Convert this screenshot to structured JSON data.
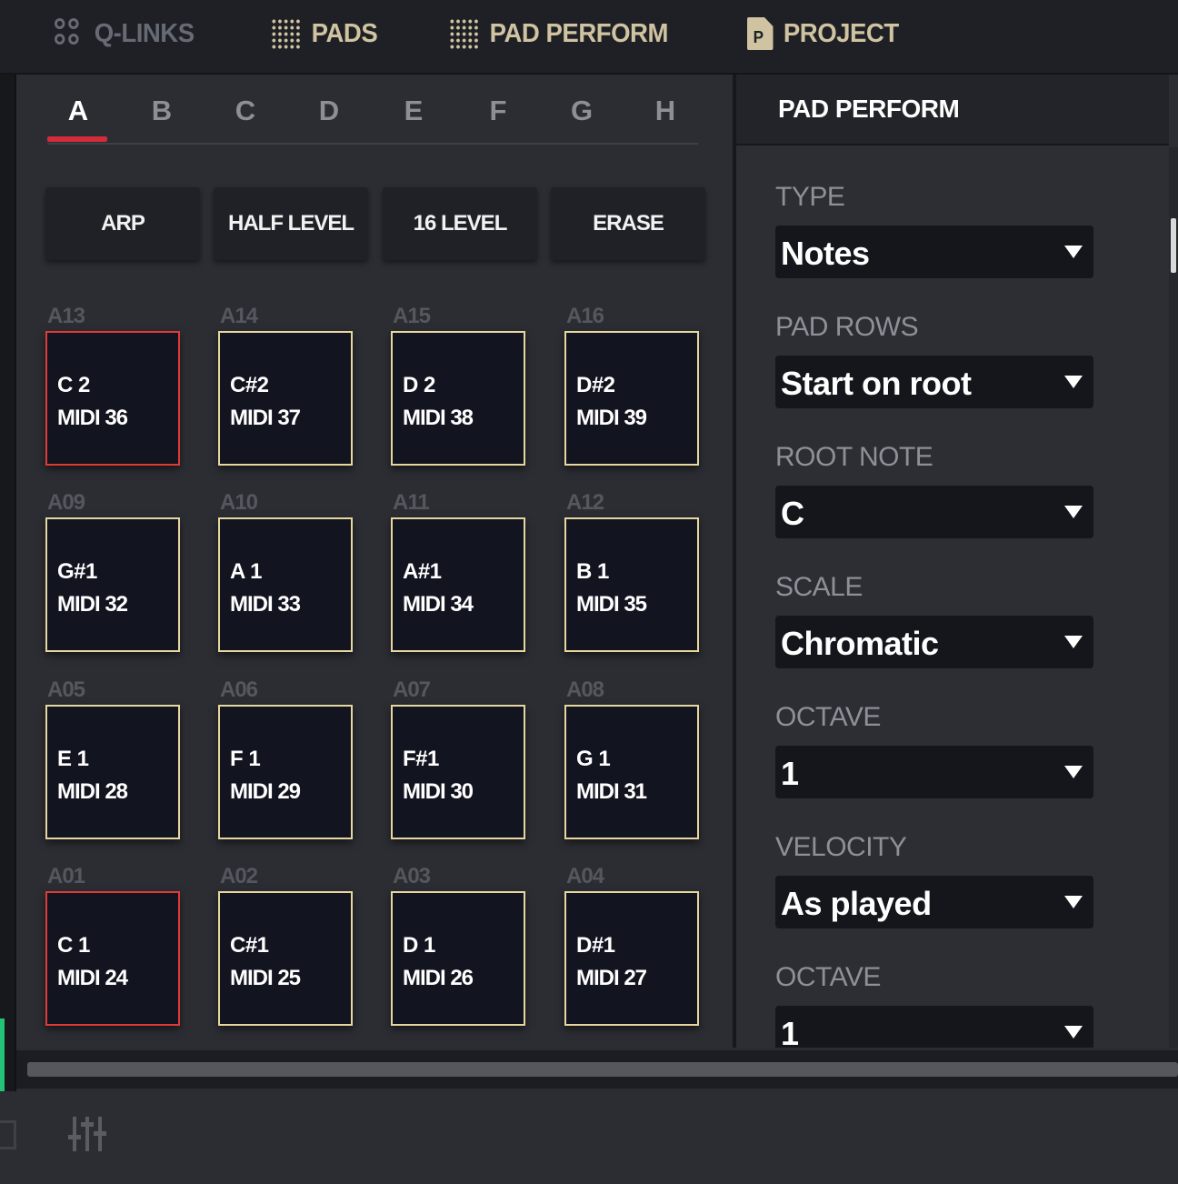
{
  "nav": {
    "items": [
      {
        "label": "Q-LINKS",
        "icon": "qlinks-icon"
      },
      {
        "label": "PADS",
        "icon": "grid-icon"
      },
      {
        "label": "PAD PERFORM",
        "icon": "grid-icon"
      },
      {
        "label": "PROJECT",
        "icon": "document-icon",
        "icon_letter": "P"
      }
    ]
  },
  "banks": [
    "A",
    "B",
    "C",
    "D",
    "E",
    "F",
    "G",
    "H"
  ],
  "active_bank": "A",
  "tools": [
    "ARP",
    "HALF LEVEL",
    "16 LEVEL",
    "ERASE"
  ],
  "pads": [
    {
      "id": "A13",
      "note": "C 2",
      "midi": "MIDI 36",
      "root": true
    },
    {
      "id": "A14",
      "note": "C#2",
      "midi": "MIDI 37",
      "root": false
    },
    {
      "id": "A15",
      "note": "D 2",
      "midi": "MIDI 38",
      "root": false
    },
    {
      "id": "A16",
      "note": "D#2",
      "midi": "MIDI 39",
      "root": false
    },
    {
      "id": "A09",
      "note": "G#1",
      "midi": "MIDI 32",
      "root": false
    },
    {
      "id": "A10",
      "note": "A 1",
      "midi": "MIDI 33",
      "root": false
    },
    {
      "id": "A11",
      "note": "A#1",
      "midi": "MIDI 34",
      "root": false
    },
    {
      "id": "A12",
      "note": "B 1",
      "midi": "MIDI 35",
      "root": false
    },
    {
      "id": "A05",
      "note": "E 1",
      "midi": "MIDI 28",
      "root": false
    },
    {
      "id": "A06",
      "note": "F 1",
      "midi": "MIDI 29",
      "root": false
    },
    {
      "id": "A07",
      "note": "F#1",
      "midi": "MIDI 30",
      "root": false
    },
    {
      "id": "A08",
      "note": "G 1",
      "midi": "MIDI 31",
      "root": false
    },
    {
      "id": "A01",
      "note": "C 1",
      "midi": "MIDI 24",
      "root": true
    },
    {
      "id": "A02",
      "note": "C#1",
      "midi": "MIDI 25",
      "root": false
    },
    {
      "id": "A03",
      "note": "D 1",
      "midi": "MIDI 26",
      "root": false
    },
    {
      "id": "A04",
      "note": "D#1",
      "midi": "MIDI 27",
      "root": false
    }
  ],
  "panel": {
    "title": "PAD PERFORM",
    "fields": [
      {
        "label": "TYPE",
        "value": "Notes"
      },
      {
        "label": "PAD ROWS",
        "value": "Start on root"
      },
      {
        "label": "ROOT NOTE",
        "value": "C"
      },
      {
        "label": "SCALE",
        "value": "Chromatic"
      },
      {
        "label": "OCTAVE",
        "value": "1"
      },
      {
        "label": "VELOCITY",
        "value": "As played"
      },
      {
        "label": "OCTAVE",
        "value": "1"
      }
    ]
  },
  "colors": {
    "pad_border": "#e6d79f",
    "root_pad_border": "#e03a37",
    "active_bank_underline": "#d42b3a",
    "nav_text": "#cfc3a1"
  }
}
